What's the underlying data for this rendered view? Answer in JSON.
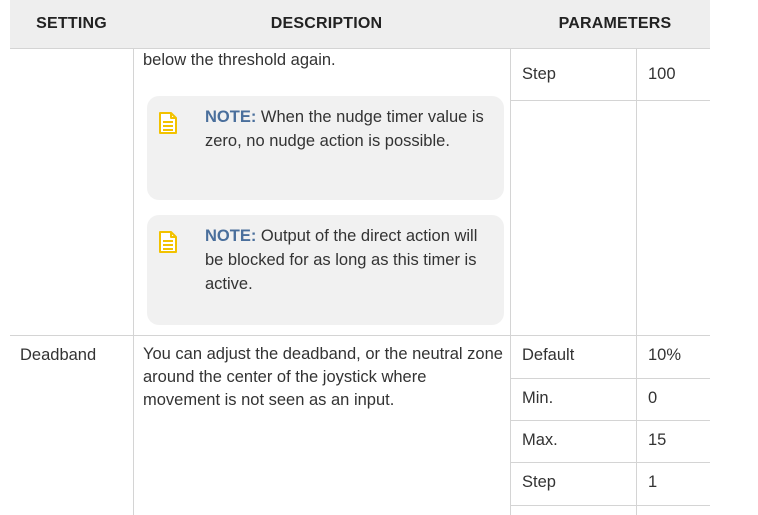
{
  "header": {
    "setting": "SETTING",
    "description": "DESCRIPTION",
    "parameters": "PARAMETERS"
  },
  "row1": {
    "description_tail": "below the threshold again.",
    "params": [
      {
        "label": "Step",
        "value": "100"
      }
    ],
    "notes": [
      {
        "label": "NOTE:",
        "text": " When the nudge timer value is zero, no nudge action is possible.",
        "icon": "note-document-icon"
      },
      {
        "label": "NOTE:",
        "text": " Output of the direct action will be blocked for as long as this timer is active.",
        "icon": "note-document-icon"
      }
    ]
  },
  "row2": {
    "setting": "Deadband",
    "description": "You can adjust the deadband, or the neutral zone around the center of the joystick where movement is not seen as an input.",
    "params": [
      {
        "label": "Default",
        "value": "10%"
      },
      {
        "label": "Min.",
        "value": "0"
      },
      {
        "label": "Max.",
        "value": "15"
      },
      {
        "label": "Step",
        "value": "1"
      }
    ]
  },
  "colors": {
    "note_label": "#4a6f9c",
    "note_icon": "#f2c200",
    "note_bg": "#f1f1f1",
    "header_bg": "#eeeeee",
    "border": "#d4d4d4"
  }
}
